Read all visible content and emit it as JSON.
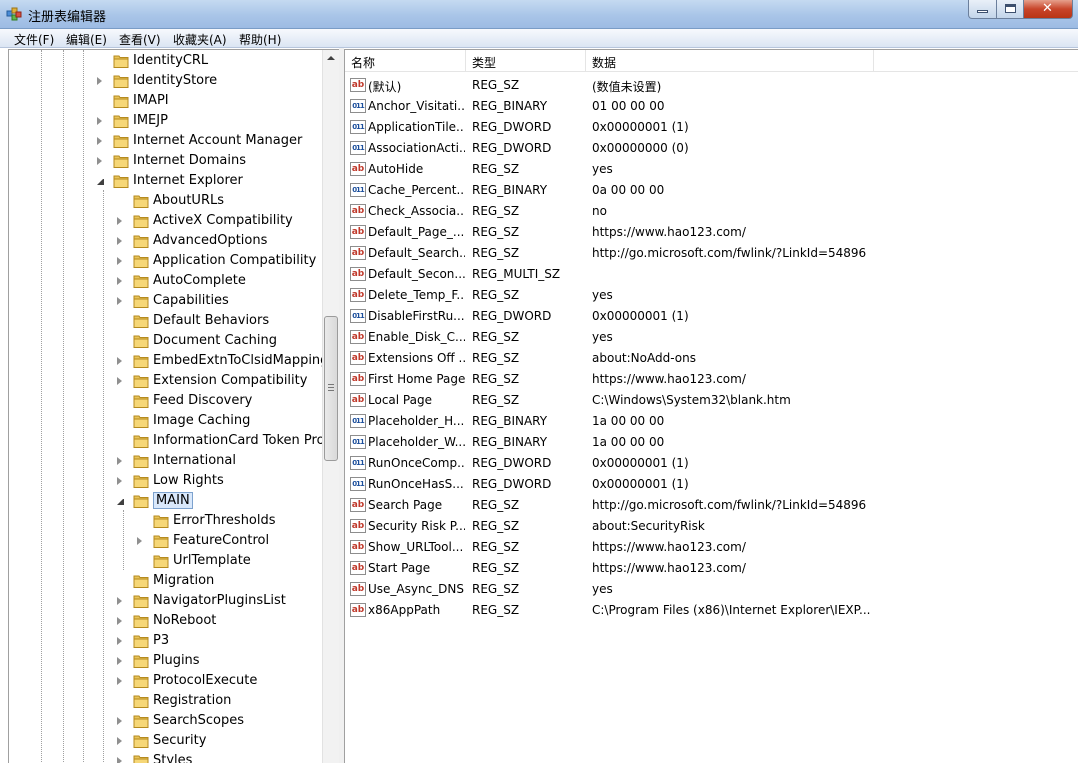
{
  "window": {
    "title": "注册表编辑器"
  },
  "menu": [
    "文件(F)",
    "编辑(E)",
    "查看(V)",
    "收藏夹(A)",
    "帮助(H)"
  ],
  "tree": {
    "items": [
      {
        "label": "IdentityCRL",
        "level": 0,
        "expander": "none"
      },
      {
        "label": "IdentityStore",
        "level": 0,
        "expander": "closed"
      },
      {
        "label": "IMAPI",
        "level": 0,
        "expander": "none"
      },
      {
        "label": "IMEJP",
        "level": 0,
        "expander": "closed"
      },
      {
        "label": "Internet Account Manager",
        "level": 0,
        "expander": "closed"
      },
      {
        "label": "Internet Domains",
        "level": 0,
        "expander": "closed"
      },
      {
        "label": "Internet Explorer",
        "level": 0,
        "expander": "open"
      },
      {
        "label": "AboutURLs",
        "level": 1,
        "expander": "none"
      },
      {
        "label": "ActiveX Compatibility",
        "level": 1,
        "expander": "closed"
      },
      {
        "label": "AdvancedOptions",
        "level": 1,
        "expander": "closed"
      },
      {
        "label": "Application Compatibility",
        "level": 1,
        "expander": "closed"
      },
      {
        "label": "AutoComplete",
        "level": 1,
        "expander": "closed"
      },
      {
        "label": "Capabilities",
        "level": 1,
        "expander": "closed"
      },
      {
        "label": "Default Behaviors",
        "level": 1,
        "expander": "none"
      },
      {
        "label": "Document Caching",
        "level": 1,
        "expander": "none"
      },
      {
        "label": "EmbedExtnToClsidMappings",
        "level": 1,
        "expander": "closed"
      },
      {
        "label": "Extension Compatibility",
        "level": 1,
        "expander": "closed"
      },
      {
        "label": "Feed Discovery",
        "level": 1,
        "expander": "none"
      },
      {
        "label": "Image Caching",
        "level": 1,
        "expander": "none"
      },
      {
        "label": "InformationCard Token Provid",
        "level": 1,
        "expander": "none"
      },
      {
        "label": "International",
        "level": 1,
        "expander": "closed"
      },
      {
        "label": "Low Rights",
        "level": 1,
        "expander": "closed"
      },
      {
        "label": "MAIN",
        "level": 1,
        "expander": "open",
        "selected": true
      },
      {
        "label": "ErrorThresholds",
        "level": 2,
        "expander": "none"
      },
      {
        "label": "FeatureControl",
        "level": 2,
        "expander": "closed"
      },
      {
        "label": "UrlTemplate",
        "level": 2,
        "expander": "none"
      },
      {
        "label": "Migration",
        "level": 1,
        "expander": "none"
      },
      {
        "label": "NavigatorPluginsList",
        "level": 1,
        "expander": "closed"
      },
      {
        "label": "NoReboot",
        "level": 1,
        "expander": "closed"
      },
      {
        "label": "P3",
        "level": 1,
        "expander": "closed"
      },
      {
        "label": "Plugins",
        "level": 1,
        "expander": "closed"
      },
      {
        "label": "ProtocolExecute",
        "level": 1,
        "expander": "closed"
      },
      {
        "label": "Registration",
        "level": 1,
        "expander": "none"
      },
      {
        "label": "SearchScopes",
        "level": 1,
        "expander": "closed"
      },
      {
        "label": "Security",
        "level": 1,
        "expander": "closed"
      },
      {
        "label": "Styles",
        "level": 1,
        "expander": "closed"
      }
    ]
  },
  "list": {
    "columns": [
      "名称",
      "类型",
      "数据"
    ],
    "rows": [
      {
        "icon": "string-value-icon",
        "name": "(默认)",
        "type": "REG_SZ",
        "data": "(数值未设置)"
      },
      {
        "icon": "binary-value-icon",
        "name": "Anchor_Visitati...",
        "type": "REG_BINARY",
        "data": "01 00 00 00"
      },
      {
        "icon": "binary-value-icon",
        "name": "ApplicationTile...",
        "type": "REG_DWORD",
        "data": "0x00000001 (1)"
      },
      {
        "icon": "binary-value-icon",
        "name": "AssociationActi...",
        "type": "REG_DWORD",
        "data": "0x00000000 (0)"
      },
      {
        "icon": "string-value-icon",
        "name": "AutoHide",
        "type": "REG_SZ",
        "data": "yes"
      },
      {
        "icon": "binary-value-icon",
        "name": "Cache_Percent...",
        "type": "REG_BINARY",
        "data": "0a 00 00 00"
      },
      {
        "icon": "string-value-icon",
        "name": "Check_Associa...",
        "type": "REG_SZ",
        "data": "no"
      },
      {
        "icon": "string-value-icon",
        "name": "Default_Page_...",
        "type": "REG_SZ",
        "data": "https://www.hao123.com/"
      },
      {
        "icon": "string-value-icon",
        "name": "Default_Search...",
        "type": "REG_SZ",
        "data": "http://go.microsoft.com/fwlink/?LinkId=54896"
      },
      {
        "icon": "string-value-icon",
        "name": "Default_Secon...",
        "type": "REG_MULTI_SZ",
        "data": ""
      },
      {
        "icon": "string-value-icon",
        "name": "Delete_Temp_F...",
        "type": "REG_SZ",
        "data": "yes"
      },
      {
        "icon": "binary-value-icon",
        "name": "DisableFirstRu...",
        "type": "REG_DWORD",
        "data": "0x00000001 (1)"
      },
      {
        "icon": "string-value-icon",
        "name": "Enable_Disk_C...",
        "type": "REG_SZ",
        "data": "yes"
      },
      {
        "icon": "string-value-icon",
        "name": "Extensions Off ...",
        "type": "REG_SZ",
        "data": "about:NoAdd-ons"
      },
      {
        "icon": "string-value-icon",
        "name": "First Home Page",
        "type": "REG_SZ",
        "data": "https://www.hao123.com/"
      },
      {
        "icon": "string-value-icon",
        "name": "Local Page",
        "type": "REG_SZ",
        "data": "C:\\Windows\\System32\\blank.htm"
      },
      {
        "icon": "binary-value-icon",
        "name": "Placeholder_H...",
        "type": "REG_BINARY",
        "data": "1a 00 00 00"
      },
      {
        "icon": "binary-value-icon",
        "name": "Placeholder_W...",
        "type": "REG_BINARY",
        "data": "1a 00 00 00"
      },
      {
        "icon": "binary-value-icon",
        "name": "RunOnceComp...",
        "type": "REG_DWORD",
        "data": "0x00000001 (1)"
      },
      {
        "icon": "binary-value-icon",
        "name": "RunOnceHasS...",
        "type": "REG_DWORD",
        "data": "0x00000001 (1)"
      },
      {
        "icon": "string-value-icon",
        "name": "Search Page",
        "type": "REG_SZ",
        "data": "http://go.microsoft.com/fwlink/?LinkId=54896"
      },
      {
        "icon": "string-value-icon",
        "name": "Security Risk P...",
        "type": "REG_SZ",
        "data": "about:SecurityRisk"
      },
      {
        "icon": "string-value-icon",
        "name": "Show_URLTool...",
        "type": "REG_SZ",
        "data": "https://www.hao123.com/"
      },
      {
        "icon": "string-value-icon",
        "name": "Start Page",
        "type": "REG_SZ",
        "data": "https://www.hao123.com/"
      },
      {
        "icon": "string-value-icon",
        "name": "Use_Async_DNS",
        "type": "REG_SZ",
        "data": "yes"
      },
      {
        "icon": "string-value-icon",
        "name": "x86AppPath",
        "type": "REG_SZ",
        "data": "C:\\Program Files (x86)\\Internet Explorer\\IEXP..."
      }
    ]
  },
  "colors": {
    "selection": "#d9e8fb",
    "folder": "#e8c45a",
    "string_icon": "#c0392b",
    "binary_icon": "#1c4f9c"
  }
}
